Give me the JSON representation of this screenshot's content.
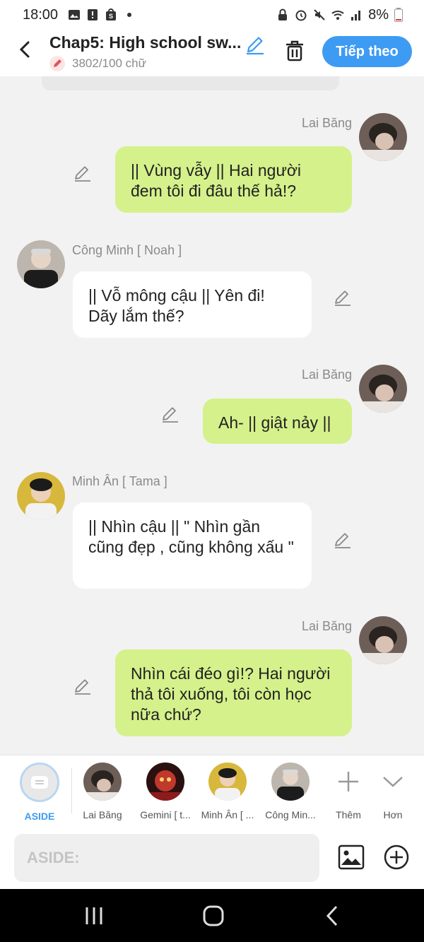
{
  "status_bar": {
    "time": "18:00",
    "battery": "8%"
  },
  "header": {
    "title": "Chap5: High school sw...",
    "char_count": "3802/100 chữ",
    "next_label": "Tiếp theo"
  },
  "messages": [
    {
      "sender": "Lai Băng",
      "side": "right",
      "text": "|| Vùng vẫy || Hai người đem tôi đi đâu thế hả!?"
    },
    {
      "sender": "Công Minh [ Noah ]",
      "side": "left",
      "text": "|| Vỗ mông cậu || Yên đi! Dãy lắm thế?"
    },
    {
      "sender": "Lai Băng",
      "side": "right",
      "text": "Ah- || giật nảy ||"
    },
    {
      "sender": "Minh Ân [ Tama ]",
      "side": "left",
      "text": "|| Nhìn cậu || \" Nhìn gần cũng đẹp , cũng không xấu \""
    },
    {
      "sender": "Lai Băng",
      "side": "right",
      "text": "Nhìn cái đéo gì!? Hai người thả tôi xuống, tôi còn học nữa chứ?"
    }
  ],
  "characters": [
    {
      "label": "ASIDE"
    },
    {
      "label": "Lai Băng"
    },
    {
      "label": "Gemini [ t..."
    },
    {
      "label": "Minh Ân [ ..."
    },
    {
      "label": "Công Min..."
    },
    {
      "label": "Thêm"
    },
    {
      "label": "Hơn"
    }
  ],
  "input": {
    "placeholder": "ASIDE:"
  },
  "colors": {
    "accent": "#3d9bf3",
    "right_bubble": "#d5f18b",
    "left_bubble": "#ffffff",
    "background": "#f2f2f2"
  }
}
